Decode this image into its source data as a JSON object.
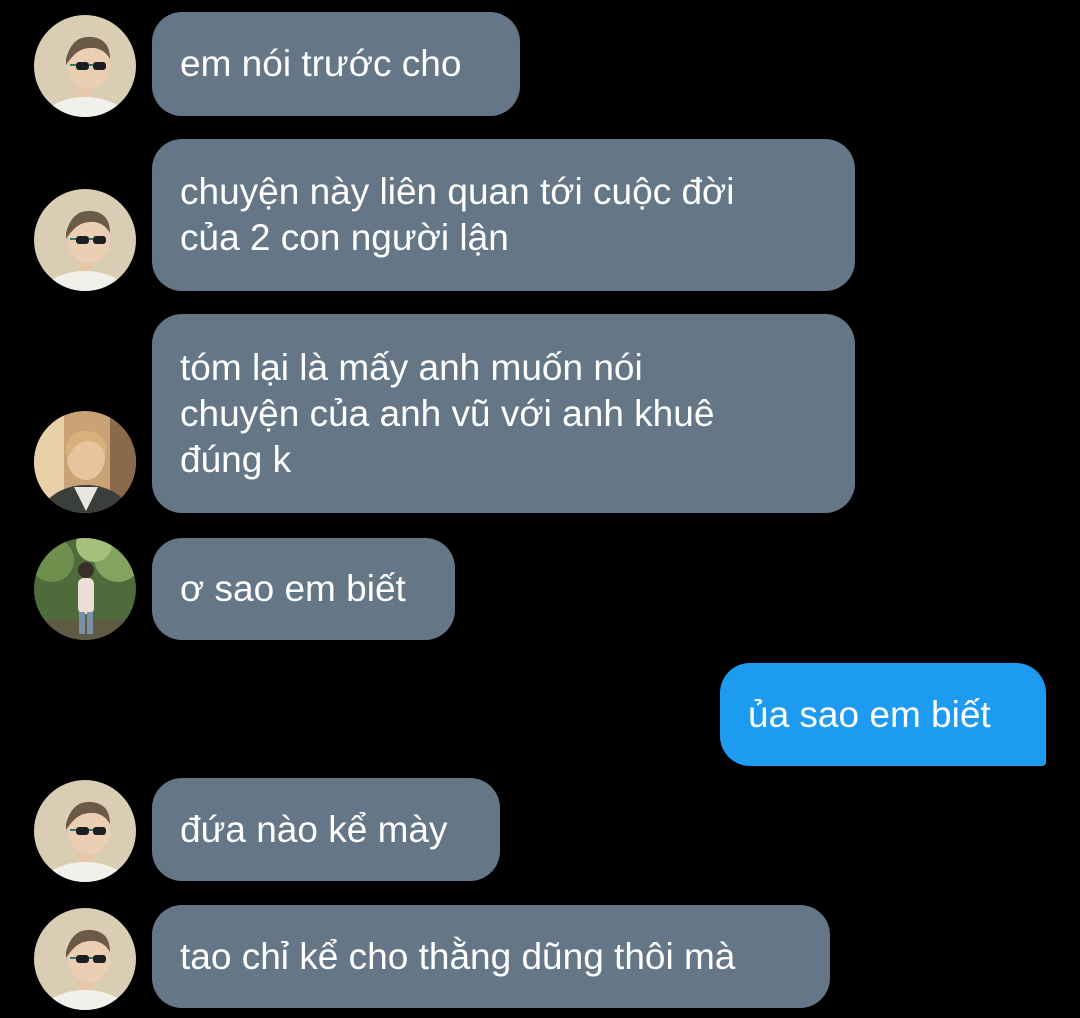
{
  "colors": {
    "background": "#000000",
    "incoming_bubble": "#657687",
    "outgoing_bubble": "#1d9bf0",
    "text": "#ffffff"
  },
  "messages": [
    {
      "direction": "incoming",
      "sender_avatar": "avatar-sunglasses",
      "text": "em nói trước cho"
    },
    {
      "direction": "incoming",
      "sender_avatar": "avatar-sunglasses",
      "text": "chuyện này liên quan tới cuộc đời\ncủa 2 con người lận"
    },
    {
      "direction": "incoming",
      "sender_avatar": "avatar-jacket",
      "text": "tóm lại là mấy anh muốn nói\nchuyện của anh vũ với anh khuê\nđúng k"
    },
    {
      "direction": "incoming",
      "sender_avatar": "avatar-park",
      "text": "ơ sao em biết"
    },
    {
      "direction": "outgoing",
      "text": "ủa sao em biết"
    },
    {
      "direction": "incoming",
      "sender_avatar": "avatar-sunglasses",
      "text": "đứa nào kể mày"
    },
    {
      "direction": "incoming",
      "sender_avatar": "avatar-sunglasses",
      "text": "tao chỉ kể cho thằng dũng thôi mà"
    }
  ]
}
